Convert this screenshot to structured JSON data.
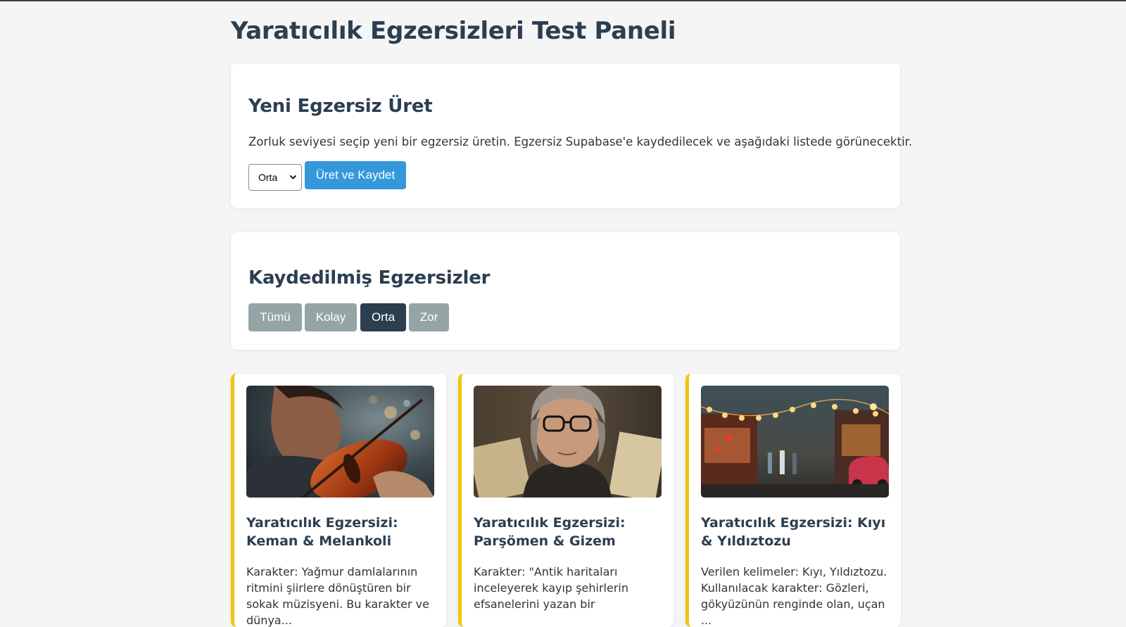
{
  "page": {
    "title": "Yaratıcılık Egzersizleri Test Paneli"
  },
  "generator": {
    "title": "Yeni Egzersiz Üret",
    "description": "Zorluk seviyesi seçip yeni bir egzersiz üretin. Egzersiz Supabase'e kaydedilecek ve aşağıdaki listede görünecektir.",
    "difficulty_selected": "Orta",
    "submit_label": "Üret ve Kaydet"
  },
  "saved": {
    "title": "Kaydedilmiş Egzersizler",
    "filters": [
      "Tümü",
      "Kolay",
      "Orta",
      "Zor"
    ],
    "active_filter": "Orta"
  },
  "cards": [
    {
      "title": "Yaratıcılık Egzersizi: Keman & Melankoli",
      "text": "Karakter: Yağmur damlalarının ritmini şiirlere dönüştüren bir sokak müzisyeni. Bu karakter ve dünya...",
      "image": "violinist-photo"
    },
    {
      "title": "Yaratıcılık Egzersizi: Parşömen & Gizem",
      "text": "Karakter: \"Antik haritaları inceleyerek kayıp şehirlerin efsanelerini yazan bir",
      "image": "woman-with-map-photo"
    },
    {
      "title": "Yaratıcılık Egzersizi: Kıyı & Yıldıztozu",
      "text": "Verilen kelimeler: Kıyı, Yıldıztozu. Kullanılacak karakter: Gözleri, gökyüzünün renginde olan, uçan ...",
      "image": "night-street-photo"
    }
  ],
  "colors": {
    "accent": "#3498db",
    "dark": "#2c3e50",
    "muted_button": "#95a5a6",
    "card_border": "#f1c40f",
    "background": "#f4f5f4"
  }
}
